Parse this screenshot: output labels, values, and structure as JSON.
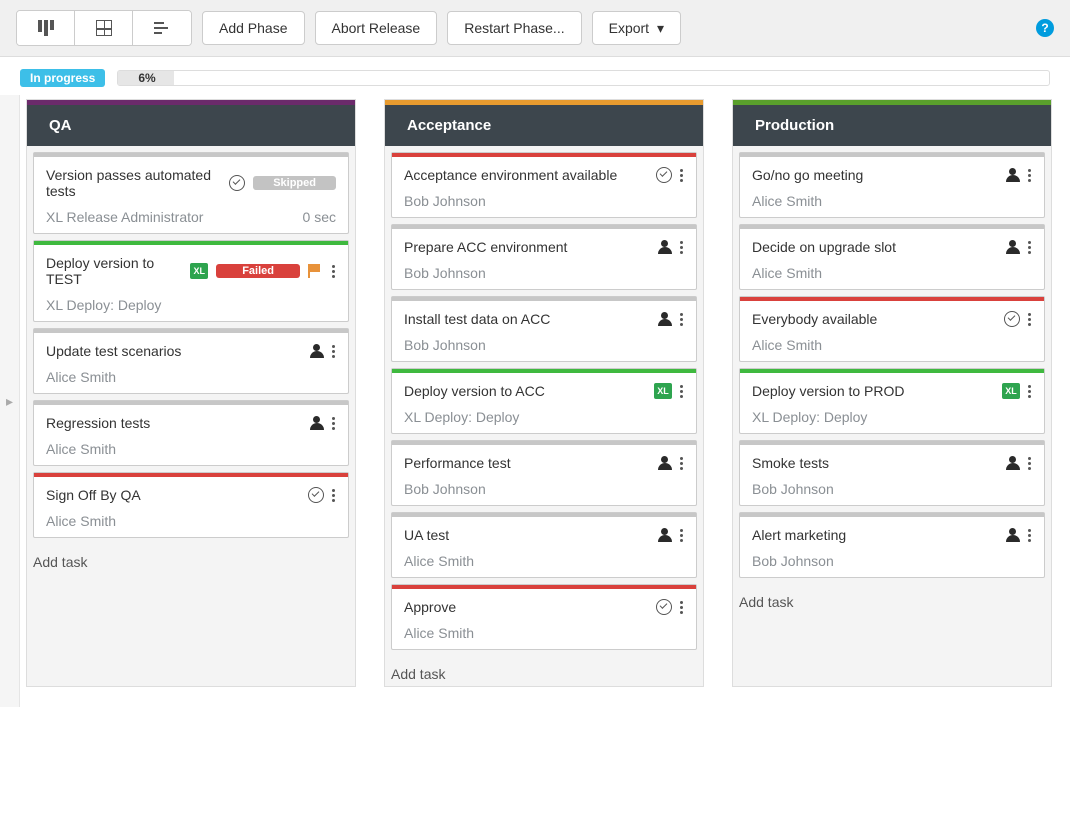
{
  "toolbar": {
    "add_phase": "Add Phase",
    "abort": "Abort Release",
    "restart": "Restart Phase...",
    "export": "Export"
  },
  "status": {
    "label": "In progress",
    "percent_text": "6%",
    "percent": 6
  },
  "add_task_label": "Add task",
  "phases": [
    {
      "name": "QA",
      "color": "#6b2a6b",
      "tasks": [
        {
          "title": "Version passes automated tests",
          "owner": "XL Release Administrator",
          "top": "grey",
          "gate": true,
          "status_badge": "Skipped",
          "meta_right": "0 sec"
        },
        {
          "title": "Deploy version to TEST",
          "owner": "XL Deploy: Deploy",
          "top": "green",
          "xl": true,
          "status_badge": "Failed",
          "flag": true,
          "dots": true
        },
        {
          "title": "Update test scenarios",
          "owner": "Alice Smith",
          "top": "grey",
          "user": true,
          "dots": true
        },
        {
          "title": "Regression tests",
          "owner": "Alice Smith",
          "top": "grey",
          "user": true,
          "dots": true
        },
        {
          "title": "Sign Off By QA",
          "owner": "Alice Smith",
          "top": "red",
          "gate": true,
          "dots": true
        }
      ]
    },
    {
      "name": "Acceptance",
      "color": "#e89b2f",
      "tasks": [
        {
          "title": "Acceptance environment available",
          "owner": "Bob Johnson",
          "top": "red",
          "gate": true,
          "dots": true
        },
        {
          "title": "Prepare ACC environment",
          "owner": "Bob Johnson",
          "top": "grey",
          "user": true,
          "dots": true
        },
        {
          "title": "Install test data on ACC",
          "owner": "Bob Johnson",
          "top": "grey",
          "user": true,
          "dots": true
        },
        {
          "title": "Deploy version to ACC",
          "owner": "XL Deploy: Deploy",
          "top": "green",
          "xl": true,
          "dots": true
        },
        {
          "title": "Performance test",
          "owner": "Bob Johnson",
          "top": "grey",
          "user": true,
          "dots": true
        },
        {
          "title": "UA test",
          "owner": "Alice Smith",
          "top": "grey",
          "user": true,
          "dots": true
        },
        {
          "title": "Approve",
          "owner": "Alice Smith",
          "top": "red",
          "gate": true,
          "dots": true
        }
      ]
    },
    {
      "name": "Production",
      "color": "#5aa02c",
      "tasks": [
        {
          "title": "Go/no go meeting",
          "owner": "Alice Smith",
          "top": "grey",
          "user": true,
          "dots": true
        },
        {
          "title": "Decide on upgrade slot",
          "owner": "Alice Smith",
          "top": "grey",
          "user": true,
          "dots": true
        },
        {
          "title": "Everybody available",
          "owner": "Alice Smith",
          "top": "red",
          "gate": true,
          "dots": true
        },
        {
          "title": "Deploy version to PROD",
          "owner": "XL Deploy: Deploy",
          "top": "green",
          "xl": true,
          "dots": true
        },
        {
          "title": "Smoke tests",
          "owner": "Bob Johnson",
          "top": "grey",
          "user": true,
          "dots": true
        },
        {
          "title": "Alert marketing",
          "owner": "Bob Johnson",
          "top": "grey",
          "user": true,
          "dots": true
        }
      ]
    }
  ]
}
